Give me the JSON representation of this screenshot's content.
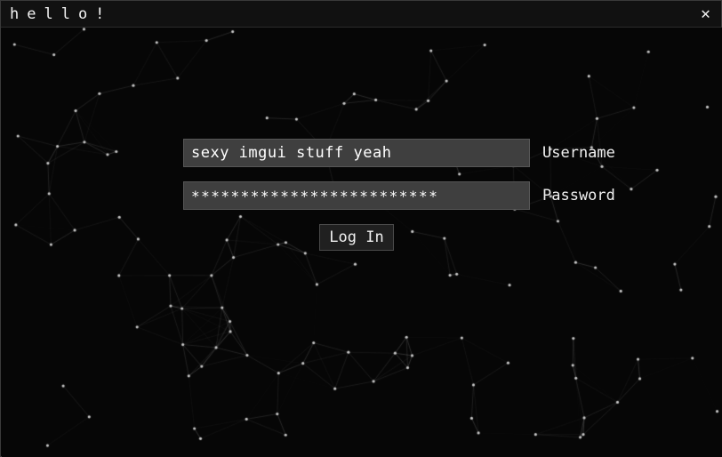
{
  "window": {
    "title": "hello!",
    "close_label": "✕"
  },
  "form": {
    "username_value": "sexy imgui stuff yeah",
    "username_label": "Username",
    "password_masked": "*************************",
    "password_label": "Password",
    "login_label": "Log In"
  },
  "colors": {
    "bg": "#060606",
    "titlebar": "#111111",
    "input_bg": "#3f3f3f",
    "text": "#f0f0f0",
    "particle": "#c8c8c8",
    "line": "#787878"
  }
}
